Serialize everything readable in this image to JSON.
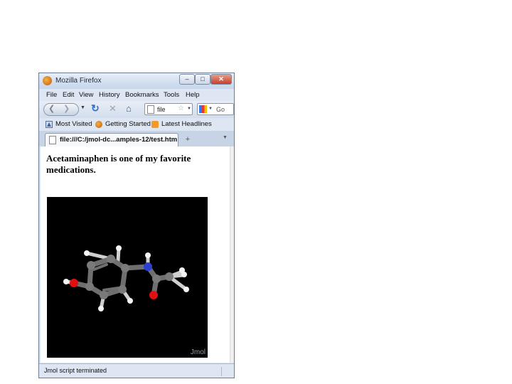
{
  "window": {
    "title": "Mozilla Firefox",
    "controls": {
      "minimize": "‒",
      "maximize": "□",
      "close": "✕"
    }
  },
  "menu": [
    "File",
    "Edit",
    "View",
    "History",
    "Bookmarks",
    "Tools",
    "Help"
  ],
  "nav": {
    "back_icon": "back-arrow-icon",
    "forward_icon": "forward-arrow-icon",
    "url": "file",
    "search_placeholder": "Go"
  },
  "bookmarks": [
    {
      "label": "Most Visited",
      "icon": "bookmark-star-icon"
    },
    {
      "label": "Getting Started",
      "icon": "firefox-icon"
    },
    {
      "label": "Latest Headlines",
      "icon": "rss-icon"
    }
  ],
  "tab": {
    "title": "file:///C:/jmol-dc...amples-12/test.htm"
  },
  "page": {
    "heading": "Acetaminaphen is one of my favorite medications.",
    "applet_label": "Jmol"
  },
  "status": {
    "text": "Jmol script terminated"
  },
  "colors": {
    "carbon": "#6f6f6f",
    "hydrogen": "#f4f4f4",
    "oxygen": "#e01010",
    "nitrogen": "#2c3fd0",
    "applet_bg": "#000000"
  }
}
